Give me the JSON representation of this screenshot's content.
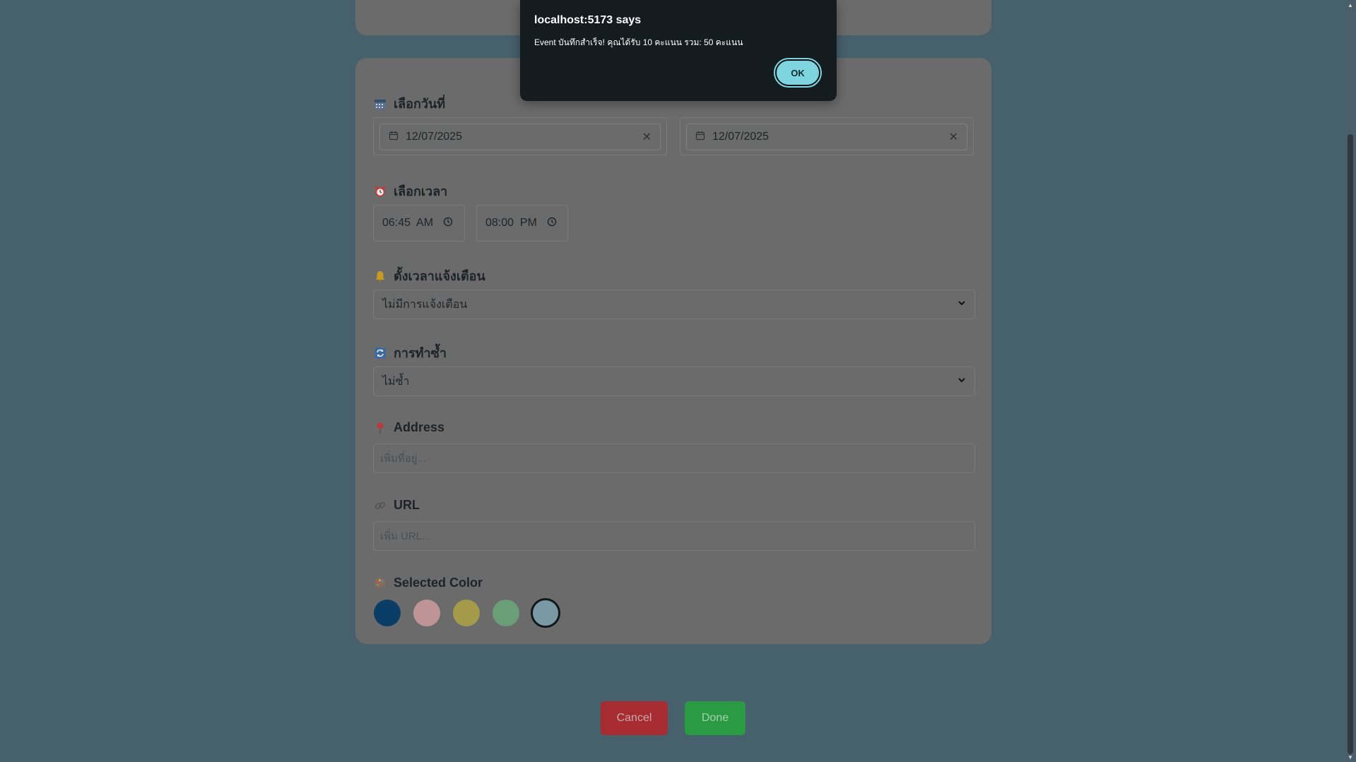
{
  "dialog": {
    "title": "localhost:5173 says",
    "message": "Event บันทึกสำเร็จ! คุณได้รับ 10 คะแนน รวม: 50 คะแนน",
    "ok_label": "OK"
  },
  "date_section": {
    "label": "เลือกวันที่",
    "start_date": "12/07/2025",
    "end_date": "12/07/2025",
    "icon": "calendar-icon"
  },
  "time_section": {
    "label": "เลือกเวลา",
    "start_time": "06:45  AM",
    "end_time": "08:00  PM",
    "icon": "alarm-clock-icon"
  },
  "reminder_section": {
    "label": "ตั้งเวลาแจ้งเตือน",
    "selected": "ไม่มีการแจ้งเตือน",
    "icon": "bell-icon"
  },
  "repeat_section": {
    "label": "การทำซ้ำ",
    "selected": "ไม่ซ้ำ",
    "icon": "repeat-icon"
  },
  "address_section": {
    "label": "Address",
    "placeholder": "เพิ่มที่อยู่...",
    "icon": "pin-icon"
  },
  "url_section": {
    "label": "URL",
    "placeholder": "เพิ่ม URL...",
    "icon": "link-icon"
  },
  "color_section": {
    "label": "Selected Color",
    "icon": "palette-icon",
    "swatches": [
      "#0a3d66",
      "#bf9497",
      "#a59a4a",
      "#6a9e76",
      "#7a99a5"
    ],
    "selected_index": 4
  },
  "actions": {
    "cancel_label": "Cancel",
    "done_label": "Done"
  }
}
